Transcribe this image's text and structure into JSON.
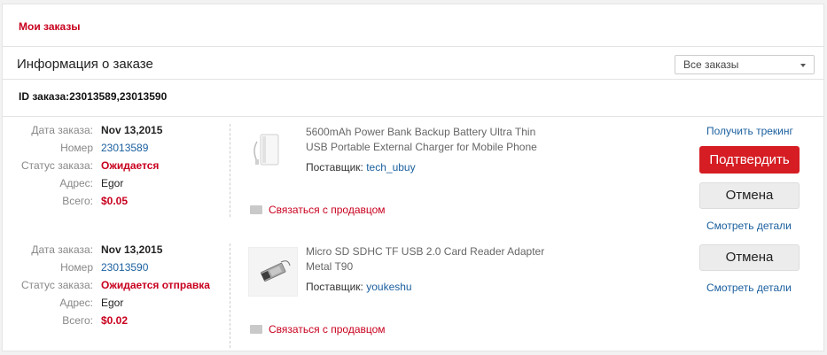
{
  "header": {
    "my_orders": "Мои заказы",
    "info_title": "Информация о заказе",
    "filter_value": "Все заказы",
    "order_ids_label": "ID заказа:",
    "order_ids": "23013589,23013590"
  },
  "labels": {
    "date": "Дата заказа:",
    "number": "Номер",
    "status": "Статус заказа:",
    "address": "Адрес:",
    "total": "Всего:",
    "supplier": "Поставщик:",
    "contact": "Связаться с продавцом",
    "tracking": "Получить трекинг",
    "confirm": "Подтвердить",
    "cancel": "Отмена",
    "details": "Смотреть детали"
  },
  "orders": [
    {
      "date": "Nov 13,2015",
      "number": "23013589",
      "status": "Ожидается",
      "address": "Egor",
      "total": "$0.05",
      "product_title": "5600mAh Power Bank Backup Battery Ultra Thin USB Portable External Charger for Mobile Phone",
      "supplier": "tech_ubuy",
      "product_icon": "power-bank-image"
    },
    {
      "date": "Nov 13,2015",
      "number": "23013590",
      "status": "Ожидается отправка",
      "address": "Egor",
      "total": "$0.02",
      "product_title": "Micro SD SDHC TF USB 2.0 Card Reader Adapter Metal T90",
      "supplier": "youkeshu",
      "product_icon": "card-reader-image"
    }
  ],
  "colors": {
    "accent_red": "#c8001e",
    "button_red": "#d51d23",
    "link_blue": "#1a5f9e"
  }
}
